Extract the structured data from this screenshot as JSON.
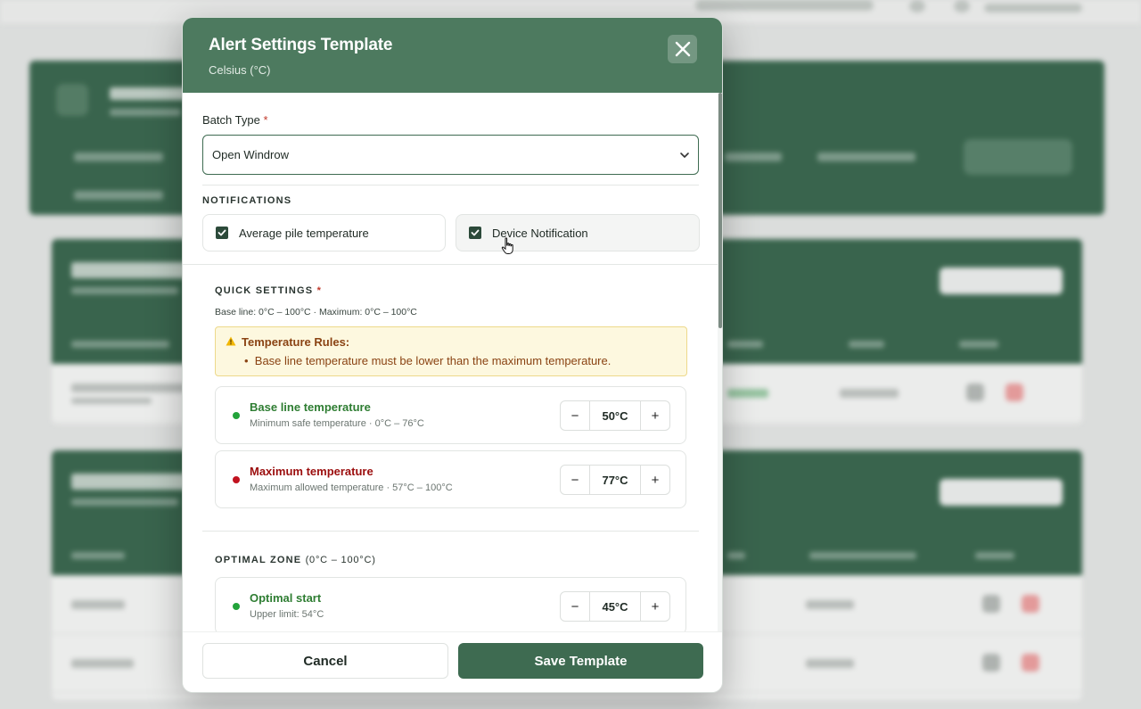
{
  "modal": {
    "title": "Alert Settings Template",
    "subtitle": "Celsius (°C)"
  },
  "batch_type": {
    "label": "Batch Type",
    "required_mark": "*",
    "value": "Open Windrow"
  },
  "notifications": {
    "heading": "NOTIFICATIONS",
    "options": [
      {
        "label": "Average pile temperature",
        "checked": true
      },
      {
        "label": "Device Notification",
        "checked": true
      }
    ]
  },
  "quick_settings": {
    "heading": "QUICK SETTINGS",
    "required_mark": "*",
    "hint": "Base line: 0°C – 100°C · Maximum: 0°C – 100°C",
    "rules": {
      "title": "Temperature Rules:",
      "items": [
        "Base line temperature must be lower than the maximum temperature."
      ]
    },
    "items": [
      {
        "name": "Base line temperature",
        "description": "Minimum safe temperature · 0°C – 76°C",
        "value": "50°C",
        "color": "#2e7d32"
      },
      {
        "name": "Maximum temperature",
        "description": "Maximum allowed temperature · 57°C – 100°C",
        "value": "77°C",
        "color": "#b71c1c"
      }
    ]
  },
  "optimal_zone": {
    "heading": "OPTIMAL ZONE",
    "range": "(0°C – 100°C)",
    "items": [
      {
        "name": "Optimal start",
        "description": "Upper limit: 54°C",
        "value": "45°C",
        "color": "#2e7d32"
      }
    ]
  },
  "stepper": {
    "decrement": "−",
    "increment": "+"
  },
  "footer": {
    "cancel_label": "Cancel",
    "save_label": "Save Template"
  },
  "colors": {
    "primary": "#3e6b51",
    "header": "#4d7a5f",
    "warning_bg": "#fdf8df",
    "warning_text": "#8a4313"
  }
}
